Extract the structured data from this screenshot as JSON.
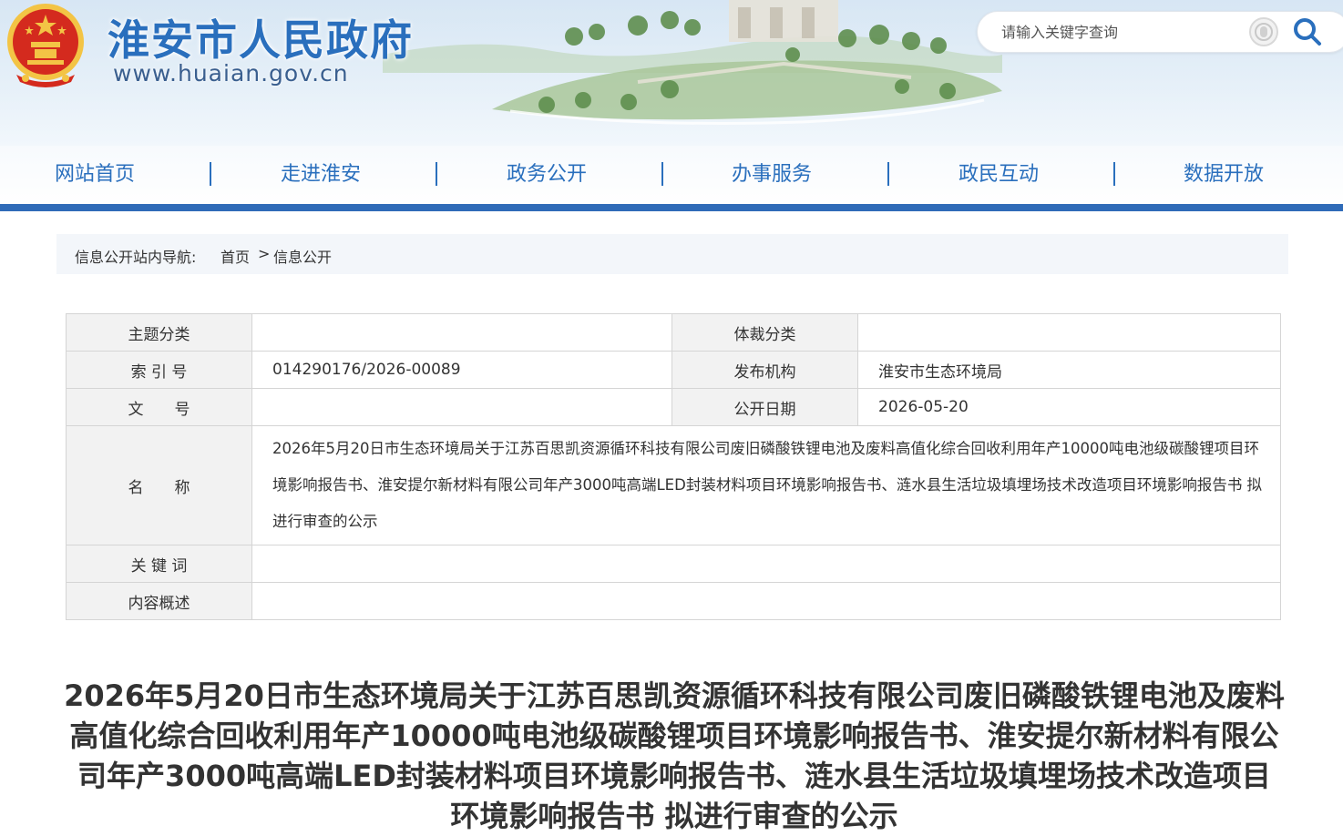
{
  "header": {
    "site_title": "淮安市人民政府",
    "site_url": "www.huaian.gov.cn",
    "search": {
      "placeholder": "请输入关键字查询"
    }
  },
  "nav": {
    "items": [
      {
        "label": "网站首页"
      },
      {
        "label": "走进淮安"
      },
      {
        "label": "政务公开"
      },
      {
        "label": "办事服务"
      },
      {
        "label": "政民互动"
      },
      {
        "label": "数据开放"
      }
    ]
  },
  "breadcrumb": {
    "label": "信息公开站内导航:",
    "home": "首页",
    "separator": ">",
    "current": "信息公开"
  },
  "info": {
    "topic_label": "主题分类",
    "topic_value": "",
    "genre_label": "体裁分类",
    "genre_value": "",
    "index_label": "索 引 号",
    "index_value": "014290176/2026-00089",
    "publisher_label": "发布机构",
    "publisher_value": "淮安市生态环境局",
    "docno_label": "文　　号",
    "docno_value": "",
    "date_label": "公开日期",
    "date_value": "2026-05-20",
    "name_label": "名　　称",
    "name_value": "2026年5月20日市生态环境局关于江苏百思凯资源循环科技有限公司废旧磷酸铁锂电池及废料高值化综合回收利用年产10000吨电池级碳酸锂项目环境影响报告书、淮安提尔新材料有限公司年产3000吨高端LED封装材料项目环境影响报告书、涟水县生活垃圾填埋场技术改造项目环境影响报告书 拟进行审查的公示",
    "keywords_label": "关 键 词",
    "keywords_value": "",
    "summary_label": "内容概述",
    "summary_value": ""
  },
  "article": {
    "title": "2026年5月20日市生态环境局关于江苏百思凯资源循环科技有限公司废旧磷酸铁锂电池及废料高值化综合回收利用年产10000吨电池级碳酸锂项目环境影响报告书、淮安提尔新材料有限公司年产3000吨高端LED封装材料项目环境影响报告书、涟水县生活垃圾填埋场技术改造项目环境影响报告书 拟进行审查的公示"
  },
  "colors": {
    "brand_blue": "#2a6fbd",
    "nav_bar": "#2f6bb8",
    "emblem_red": "#d42a1e",
    "emblem_gold": "#f3c445"
  },
  "icons": {
    "emblem": "national-emblem",
    "voice": "accessibility-icon",
    "search": "search-icon"
  }
}
